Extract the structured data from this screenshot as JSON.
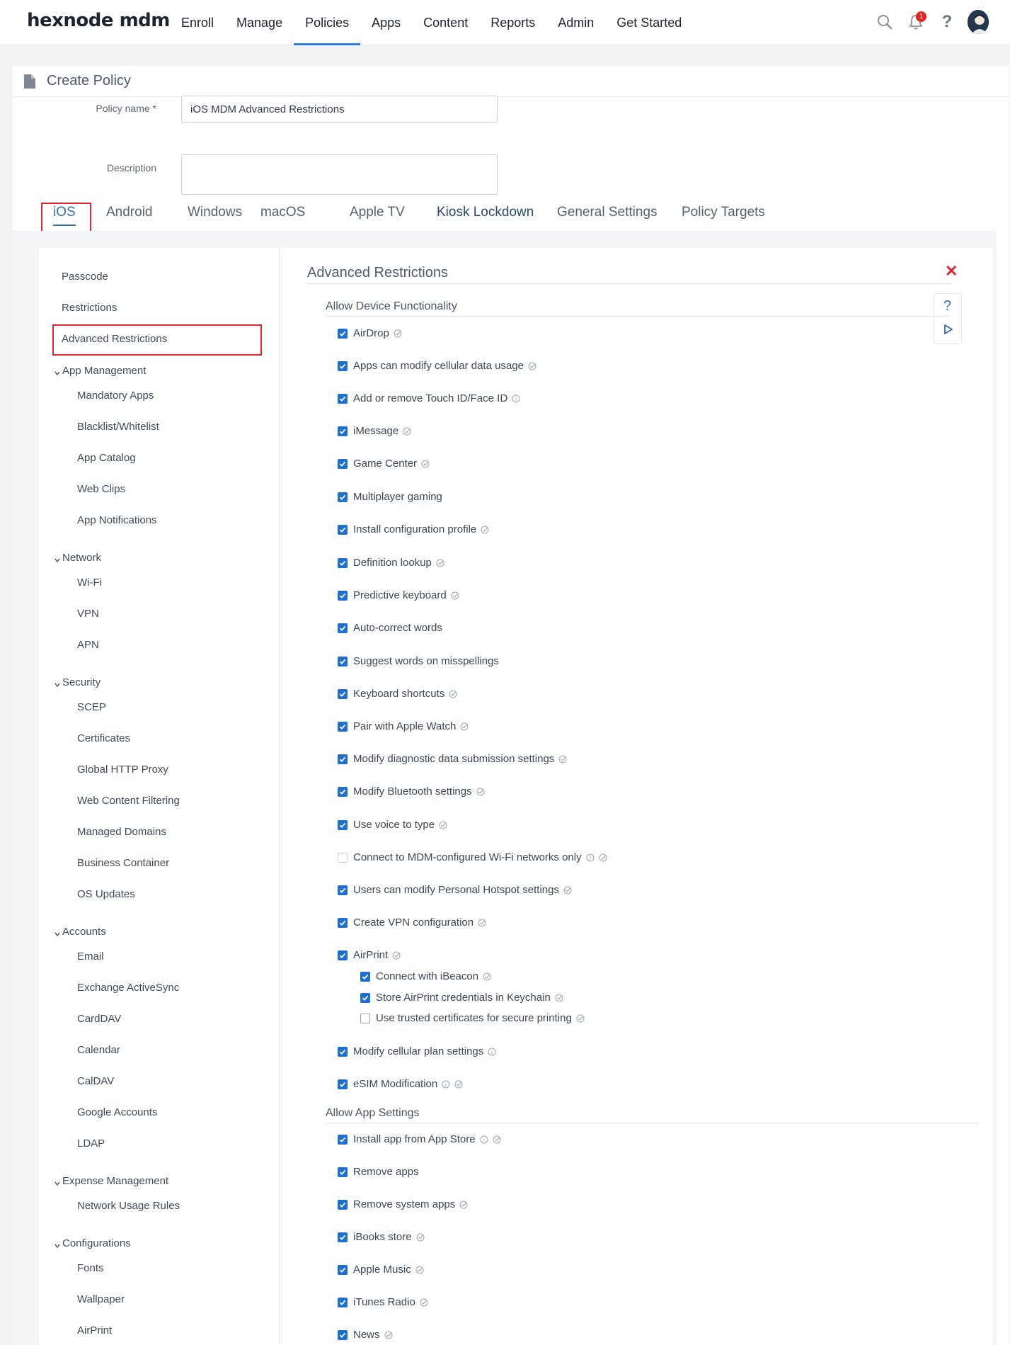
{
  "brand": {
    "logo": "hexnode mdm"
  },
  "nav": {
    "items": [
      "Enroll",
      "Manage",
      "Policies",
      "Apps",
      "Content",
      "Reports",
      "Admin",
      "Get Started"
    ],
    "active": "Policies"
  },
  "topbar": {
    "notification_count": "1",
    "help": "?"
  },
  "page": {
    "title": "Create Policy"
  },
  "form": {
    "policy_name_label": "Policy name *",
    "policy_name_value": "iOS MDM Advanced Restrictions",
    "description_label": "Description",
    "description_value": ""
  },
  "os_tabs": [
    "iOS",
    "Android",
    "Windows",
    "macOS",
    "Apple TV",
    "Kiosk Lockdown",
    "General Settings",
    "Policy Targets"
  ],
  "sidebar": {
    "top_items": [
      "Passcode",
      "Restrictions",
      "Advanced Restrictions"
    ],
    "sections": [
      {
        "title": "App Management",
        "items": [
          "Mandatory Apps",
          "Blacklist/Whitelist",
          "App Catalog",
          "Web Clips",
          "App Notifications"
        ]
      },
      {
        "title": "Network",
        "items": [
          "Wi-Fi",
          "VPN",
          "APN"
        ]
      },
      {
        "title": "Security",
        "items": [
          "SCEP",
          "Certificates",
          "Global HTTP Proxy",
          "Web Content Filtering",
          "Managed Domains",
          "Business Container",
          "OS Updates"
        ]
      },
      {
        "title": "Accounts",
        "items": [
          "Email",
          "Exchange ActiveSync",
          "CardDAV",
          "Calendar",
          "CalDAV",
          "Google Accounts",
          "LDAP"
        ]
      },
      {
        "title": "Expense Management",
        "items": [
          "Network Usage Rules"
        ]
      },
      {
        "title": "Configurations",
        "items": [
          "Fonts",
          "Wallpaper",
          "AirPrint"
        ]
      }
    ]
  },
  "main": {
    "title": "Advanced Restrictions",
    "tools": {
      "help": "?"
    },
    "groups": [
      {
        "title": "Allow Device Functionality",
        "options": [
          {
            "label": "AirDrop",
            "checked": true,
            "info": false,
            "supervised": true
          },
          {
            "label": "Apps can modify cellular data usage",
            "checked": true,
            "info": false,
            "supervised": true
          },
          {
            "label": "Add or remove Touch ID/Face ID",
            "checked": true,
            "info": true,
            "supervised": false
          },
          {
            "label": "iMessage",
            "checked": true,
            "info": false,
            "supervised": true
          },
          {
            "label": "Game Center",
            "checked": true,
            "info": false,
            "supervised": true
          },
          {
            "label": "Multiplayer gaming",
            "checked": true,
            "info": false,
            "supervised": false
          },
          {
            "label": "Install configuration profile",
            "checked": true,
            "info": false,
            "supervised": true
          },
          {
            "label": "Definition lookup",
            "checked": true,
            "info": false,
            "supervised": true
          },
          {
            "label": "Predictive keyboard",
            "checked": true,
            "info": false,
            "supervised": true
          },
          {
            "label": "Auto-correct words",
            "checked": true,
            "info": false,
            "supervised": false
          },
          {
            "label": "Suggest words on misspellings",
            "checked": true,
            "info": false,
            "supervised": false
          },
          {
            "label": "Keyboard shortcuts",
            "checked": true,
            "info": false,
            "supervised": true
          },
          {
            "label": "Pair with Apple Watch",
            "checked": true,
            "info": false,
            "supervised": true
          },
          {
            "label": "Modify diagnostic data submission settings",
            "checked": true,
            "info": false,
            "supervised": true
          },
          {
            "label": "Modify Bluetooth settings",
            "checked": true,
            "info": false,
            "supervised": true
          },
          {
            "label": "Use voice to type",
            "checked": true,
            "info": false,
            "supervised": true
          },
          {
            "label": "Connect to MDM-configured Wi-Fi networks only",
            "checked": false,
            "info": true,
            "supervised": true
          },
          {
            "label": "Users can modify Personal Hotspot settings",
            "checked": true,
            "info": false,
            "supervised": true
          },
          {
            "label": "Create VPN configuration",
            "checked": true,
            "info": false,
            "supervised": true
          },
          {
            "label": "AirPrint",
            "checked": true,
            "info": false,
            "supervised": true
          },
          {
            "label": "Connect with iBeacon",
            "checked": true,
            "info": false,
            "supervised": true,
            "sub": true
          },
          {
            "label": "Store AirPrint credentials in Keychain",
            "checked": true,
            "info": false,
            "supervised": true,
            "sub": true
          },
          {
            "label": "Use trusted certificates for secure printing",
            "checked": false,
            "info": false,
            "supervised": true,
            "sub": true
          },
          {
            "label": "Modify cellular plan settings",
            "checked": true,
            "info": true,
            "supervised": false
          },
          {
            "label": "eSIM Modification",
            "checked": true,
            "info": true,
            "supervised": true
          }
        ]
      },
      {
        "title": "Allow App Settings",
        "options": [
          {
            "label": "Install app from App Store",
            "checked": true,
            "info": true,
            "supervised": true
          },
          {
            "label": "Remove apps",
            "checked": true,
            "info": false,
            "supervised": false
          },
          {
            "label": "Remove system apps",
            "checked": true,
            "info": false,
            "supervised": true
          },
          {
            "label": "iBooks store",
            "checked": true,
            "info": false,
            "supervised": true
          },
          {
            "label": "Apple Music",
            "checked": true,
            "info": false,
            "supervised": true
          },
          {
            "label": "iTunes Radio",
            "checked": true,
            "info": false,
            "supervised": true
          },
          {
            "label": "News",
            "checked": true,
            "info": false,
            "supervised": true
          }
        ]
      }
    ]
  },
  "colors": {
    "accent": "#1f6fd1",
    "nav_underline": "#2c7be5",
    "highlight_box": "#e0262f",
    "badge": "#e02424"
  }
}
